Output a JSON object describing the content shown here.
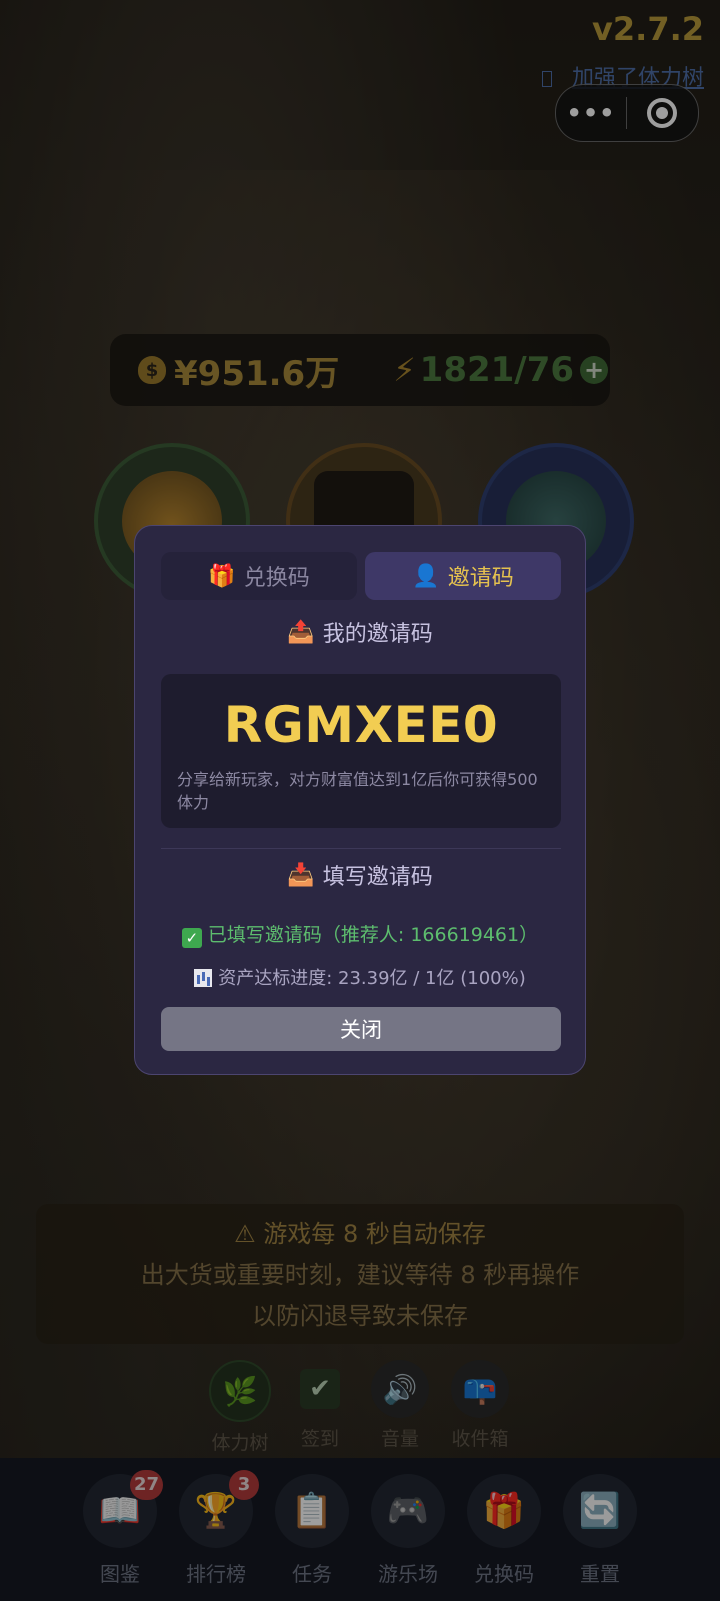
{
  "header": {
    "version": "v2.7.2",
    "update_note": "加强了体力树",
    "capsule_more": "•••"
  },
  "stats": {
    "money": "¥951.6万",
    "energy": "1821/76",
    "money_icon": "$",
    "energy_icon": "⚡",
    "plus_icon": "+"
  },
  "modal": {
    "tabs": [
      {
        "label": "兑换码",
        "icon": "🎁",
        "active": false
      },
      {
        "label": "邀请码",
        "icon": "👤",
        "active": true
      }
    ],
    "my_code_title": "我的邀请码",
    "my_code_icon": "📤",
    "code": "RGMXEE0",
    "code_hint": "分享给新玩家，对方财富值达到1亿后你可获得500 体力",
    "fill_title": "填写邀请码",
    "fill_icon": "📥",
    "filled_status": "已填写邀请码（推荐人: 166619461）",
    "progress": "资产达标进度: 23.39亿 / 1亿 (100%)",
    "close_label": "关闭"
  },
  "notice": {
    "line1": "游戏每 8 秒自动保存",
    "line2": "出大货或重要时刻，建议等待 8 秒再操作",
    "line3": "以防闪退导致未保存",
    "warn_icon": "⚠"
  },
  "quick_actions": [
    {
      "label": "体力树",
      "icon": "leaf-icon",
      "glyph": "🌿"
    },
    {
      "label": "签到",
      "icon": "checkmark-icon",
      "glyph": "✔"
    },
    {
      "label": "音量",
      "icon": "speaker-icon",
      "glyph": "🔊"
    },
    {
      "label": "收件箱",
      "icon": "mailbox-icon",
      "glyph": "📪"
    }
  ],
  "bottom_nav": [
    {
      "label": "图鉴",
      "icon": "book-icon",
      "glyph": "📖",
      "badge": "27"
    },
    {
      "label": "排行榜",
      "icon": "trophy-icon",
      "glyph": "🏆",
      "badge": "3"
    },
    {
      "label": "任务",
      "icon": "clipboard-icon",
      "glyph": "📋",
      "badge": ""
    },
    {
      "label": "游乐场",
      "icon": "gamepad-icon",
      "glyph": "🎮",
      "badge": ""
    },
    {
      "label": "兑换码",
      "icon": "gift-icon",
      "glyph": "🎁",
      "badge": ""
    },
    {
      "label": "重置",
      "icon": "refresh-icon",
      "glyph": "🔄",
      "badge": ""
    }
  ],
  "colors": {
    "accent_gold": "#f2cd52",
    "modal_bg": "#2b2742",
    "success_green": "#5dbd6e",
    "badge_red": "#b23a3a"
  }
}
